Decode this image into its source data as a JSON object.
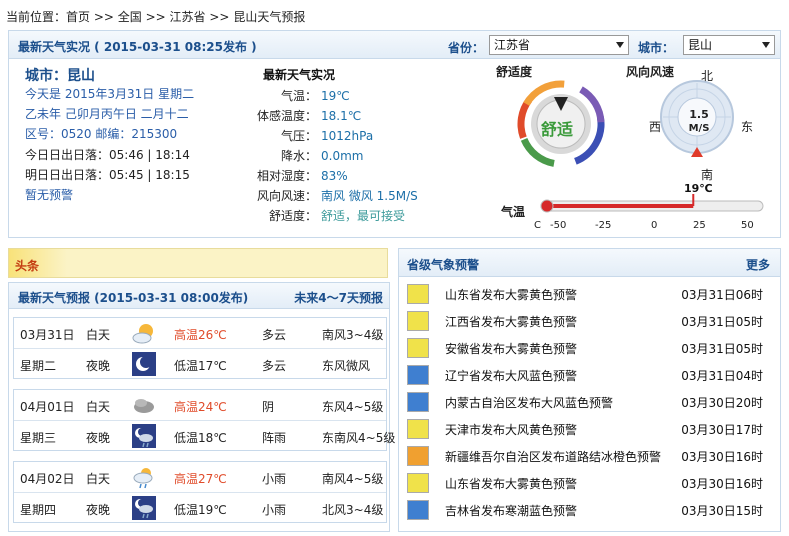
{
  "breadcrumb": {
    "prefix": "当前位置：",
    "items": [
      "首页",
      "全国",
      "江苏省",
      "昆山天气预报"
    ],
    "separators": [
      " >> ",
      " >> ",
      " >> "
    ]
  },
  "live": {
    "header_title": "最新天气实况 ( 2015-03-31  08:25发布 )",
    "province_label": "省份：",
    "province_value": "江苏省",
    "city_label": "城市：",
    "city_value": "昆山",
    "city_name": "城市：昆山",
    "today": "今天是  2015年3月31日  星期二",
    "lunar": "乙未年  己卯月丙午日  二月十二",
    "area_code": "区号：0520   邮编：215300",
    "today_sun": "今日日出日落：05:46  |  18:14",
    "tomorrow_sun": "明日日出日落：05:45  |  18:15",
    "no_warning": "暂无预警",
    "section_title": "最新天气实况",
    "rows": [
      {
        "label": "气温：",
        "value": "19℃"
      },
      {
        "label": "体感温度：",
        "value": "18.1℃"
      },
      {
        "label": "气压：",
        "value": "1012hPa"
      },
      {
        "label": "降水：",
        "value": "0.0mm"
      },
      {
        "label": "相对湿度：",
        "value": "83%"
      },
      {
        "label": "风向风速：",
        "value": "南风  微风  1.5M/S"
      },
      {
        "label": "舒适度：",
        "value": "舒适，最可接受"
      }
    ],
    "comfort_title": "舒适度",
    "comfort_value": "舒适",
    "wind_title": "风向风速",
    "wind_speed": "1.5",
    "wind_unit": "M/S",
    "wind_dirs": {
      "n": "北",
      "s": "南",
      "e": "东",
      "w": "西"
    },
    "wind_direction_deg": 180,
    "temp_label": "气温",
    "temp_value": "19℃",
    "temp_current": 19,
    "temp_scale": {
      "unit": "C",
      "ticks": [
        "-50",
        "-25",
        "0",
        "25",
        "50"
      ],
      "min": -50,
      "max": 50
    }
  },
  "headline": {
    "tag": "头条"
  },
  "forecast": {
    "title": "最新天气预报 (2015-03-31  08:00发布)",
    "more": "未来4～7天预报",
    "days": [
      {
        "date": "03月31日",
        "weekday": "星期二",
        "day": {
          "period": "白天",
          "icon": "partly-cloudy-sun-icon",
          "temp": "高温26℃",
          "weather": "多云",
          "wind": "南风3~4级"
        },
        "night": {
          "period": "夜晚",
          "icon": "moon-night-icon",
          "temp": "低温17℃",
          "weather": "多云",
          "wind": "东风微风"
        }
      },
      {
        "date": "04月01日",
        "weekday": "星期三",
        "day": {
          "period": "白天",
          "icon": "overcast-icon",
          "temp": "高温24℃",
          "weather": "阴",
          "wind": "东风4~5级"
        },
        "night": {
          "period": "夜晚",
          "icon": "night-shower-icon",
          "temp": "低温18℃",
          "weather": "阵雨",
          "wind": "东南风4~5级"
        }
      },
      {
        "date": "04月02日",
        "weekday": "星期四",
        "day": {
          "period": "白天",
          "icon": "light-rain-icon",
          "temp": "高温27℃",
          "weather": "小雨",
          "wind": "南风4~5级"
        },
        "night": {
          "period": "夜晚",
          "icon": "night-light-rain-icon",
          "temp": "低温19℃",
          "weather": "小雨",
          "wind": "北风3~4级"
        }
      }
    ]
  },
  "warnings": {
    "title": "省级气象预警",
    "more": "更多",
    "items": [
      {
        "icon": "fog-yellow-icon",
        "text": "山东省发布大雾黄色预警",
        "time": "03月31日06时",
        "color": "#f0e24a"
      },
      {
        "icon": "fog-yellow-icon",
        "text": "江西省发布大雾黄色预警",
        "time": "03月31日05时",
        "color": "#f0e24a"
      },
      {
        "icon": "fog-yellow-icon",
        "text": "安徽省发布大雾黄色预警",
        "time": "03月31日05时",
        "color": "#f0e24a"
      },
      {
        "icon": "gale-blue-icon",
        "text": "辽宁省发布大风蓝色预警",
        "time": "03月31日04时",
        "color": "#3f7fd0"
      },
      {
        "icon": "gale-blue-icon",
        "text": "内蒙古自治区发布大风蓝色预警",
        "time": "03月30日20时",
        "color": "#3f7fd0"
      },
      {
        "icon": "gale-yellow-icon",
        "text": "天津市发布大风黄色预警",
        "time": "03月30日17时",
        "color": "#f0e24a"
      },
      {
        "icon": "road-icing-orange-icon",
        "text": "新疆维吾尔自治区发布道路结冰橙色预警",
        "time": "03月30日16时",
        "color": "#f0a030"
      },
      {
        "icon": "fog-yellow-icon",
        "text": "山东省发布大雾黄色预警",
        "time": "03月30日16时",
        "color": "#f0e24a"
      },
      {
        "icon": "cold-wave-blue-icon",
        "text": "吉林省发布寒潮蓝色预警",
        "time": "03月30日15时",
        "color": "#3f7fd0"
      }
    ]
  }
}
